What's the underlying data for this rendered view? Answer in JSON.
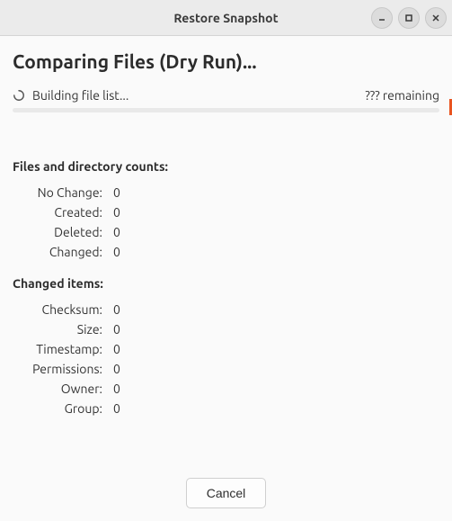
{
  "window": {
    "title": "Restore Snapshot"
  },
  "page": {
    "heading": "Comparing Files (Dry Run)..."
  },
  "status": {
    "text": "Building file list...",
    "remaining": "??? remaining"
  },
  "sections": {
    "counts_heading": "Files and directory counts:",
    "changed_heading": "Changed items:"
  },
  "counts": {
    "no_change_label": "No Change:",
    "no_change_value": "0",
    "created_label": "Created:",
    "created_value": "0",
    "deleted_label": "Deleted:",
    "deleted_value": "0",
    "changed_label": "Changed:",
    "changed_value": "0"
  },
  "changed": {
    "checksum_label": "Checksum:",
    "checksum_value": "0",
    "size_label": "Size:",
    "size_value": "0",
    "timestamp_label": "Timestamp:",
    "timestamp_value": "0",
    "permissions_label": "Permissions:",
    "permissions_value": "0",
    "owner_label": "Owner:",
    "owner_value": "0",
    "group_label": "Group:",
    "group_value": "0"
  },
  "footer": {
    "cancel_label": "Cancel"
  }
}
